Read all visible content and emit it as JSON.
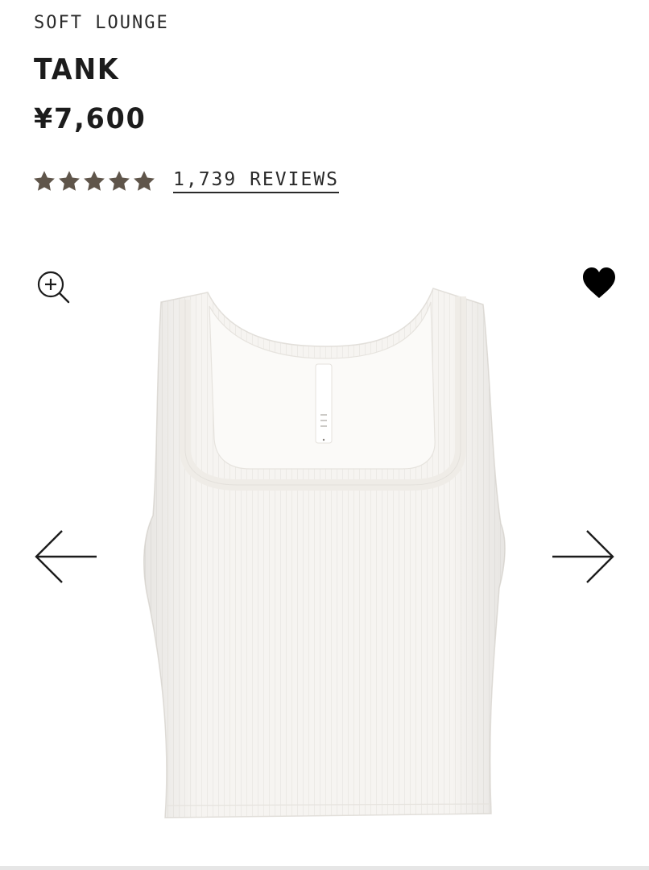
{
  "product": {
    "collection": "SOFT LOUNGE",
    "title": "TANK",
    "price": "¥7,600"
  },
  "rating": {
    "stars": 5,
    "max_stars": 5,
    "star_color": "#5f554a",
    "reviews_label": "1,739 REVIEWS"
  },
  "gallery": {
    "zoom_icon": "zoom-in-icon",
    "favorite_icon": "heart-filled-icon",
    "prev_icon": "arrow-left-icon",
    "next_icon": "arrow-right-icon",
    "image_subject": "white ribbed tank top",
    "garment_color": "#f6f4f1"
  }
}
